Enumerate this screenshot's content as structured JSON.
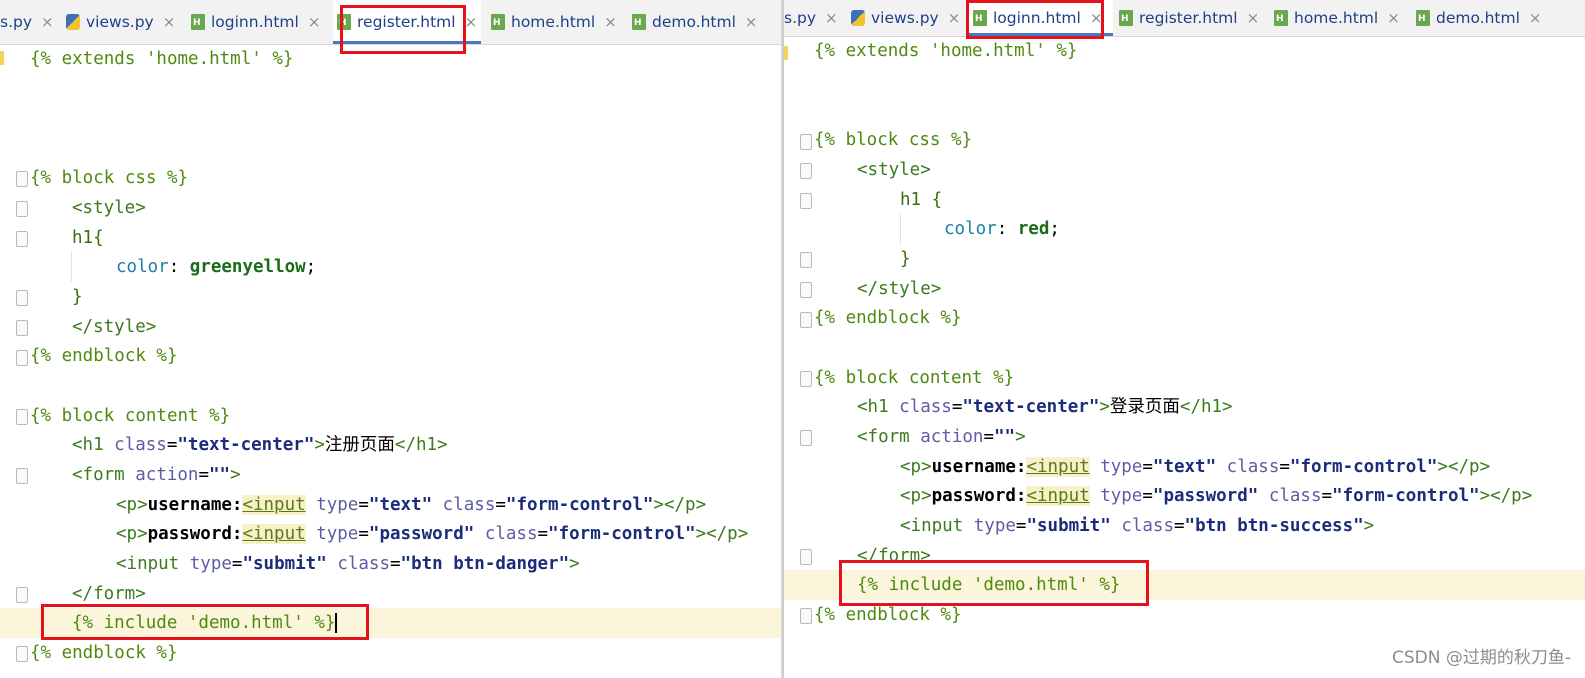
{
  "left_tabs": [
    {
      "label": "s.py",
      "icon": "python-file-icon",
      "active": false
    },
    {
      "label": "views.py",
      "icon": "python-file-icon",
      "active": false
    },
    {
      "label": "loginn.html",
      "icon": "html-file-icon",
      "active": false
    },
    {
      "label": "register.html",
      "icon": "html-file-icon",
      "active": true
    },
    {
      "label": "home.html",
      "icon": "html-file-icon",
      "active": false
    },
    {
      "label": "demo.html",
      "icon": "html-file-icon",
      "active": false
    }
  ],
  "right_tabs": [
    {
      "label": "s.py",
      "icon": "python-file-icon",
      "active": false
    },
    {
      "label": "views.py",
      "icon": "python-file-icon",
      "active": false
    },
    {
      "label": "loginn.html",
      "icon": "html-file-icon",
      "active": true
    },
    {
      "label": "register.html",
      "icon": "html-file-icon",
      "active": false
    },
    {
      "label": "home.html",
      "icon": "html-file-icon",
      "active": false
    },
    {
      "label": "demo.html",
      "icon": "html-file-icon",
      "active": false
    }
  ],
  "close_glyph": "×",
  "left_code": {
    "extends": "{% extends 'home.html' %}",
    "block_css": "{% block css %}",
    "style_open": "<style>",
    "h1_sel": "h1{",
    "prop": "color",
    "value": "greenyellow",
    "close_brace": "}",
    "style_close": "</style>",
    "endblock": "{% endblock %}",
    "block_content": "{% block content %}",
    "h1_text": "注册页面",
    "form_action": "\"\"",
    "username": "username:",
    "password": "password:",
    "submit_class": "\"btn btn-danger\"",
    "form_close": "</form>",
    "include": "{% include 'demo.html' %}",
    "endblock2": "{% endblock %}"
  },
  "right_code": {
    "extends": "{% extends 'home.html' %}",
    "block_css": "{% block css %}",
    "style_open": "<style>",
    "h1_sel": "h1 {",
    "prop": "color",
    "value": "red",
    "close_brace": "}",
    "style_close": "</style>",
    "endblock": "{% endblock %}",
    "block_content": "{% block content %}",
    "h1_text": "登录页面",
    "form_action": "\"\"",
    "username": "username:",
    "password": "password:",
    "submit_class": "\"btn btn-success\"",
    "form_close": "</form>",
    "include": "{% include 'demo.html' %}",
    "endblock2": "{% endblock %}"
  },
  "watermark": "CSDN @过期的秋刀鱼-"
}
